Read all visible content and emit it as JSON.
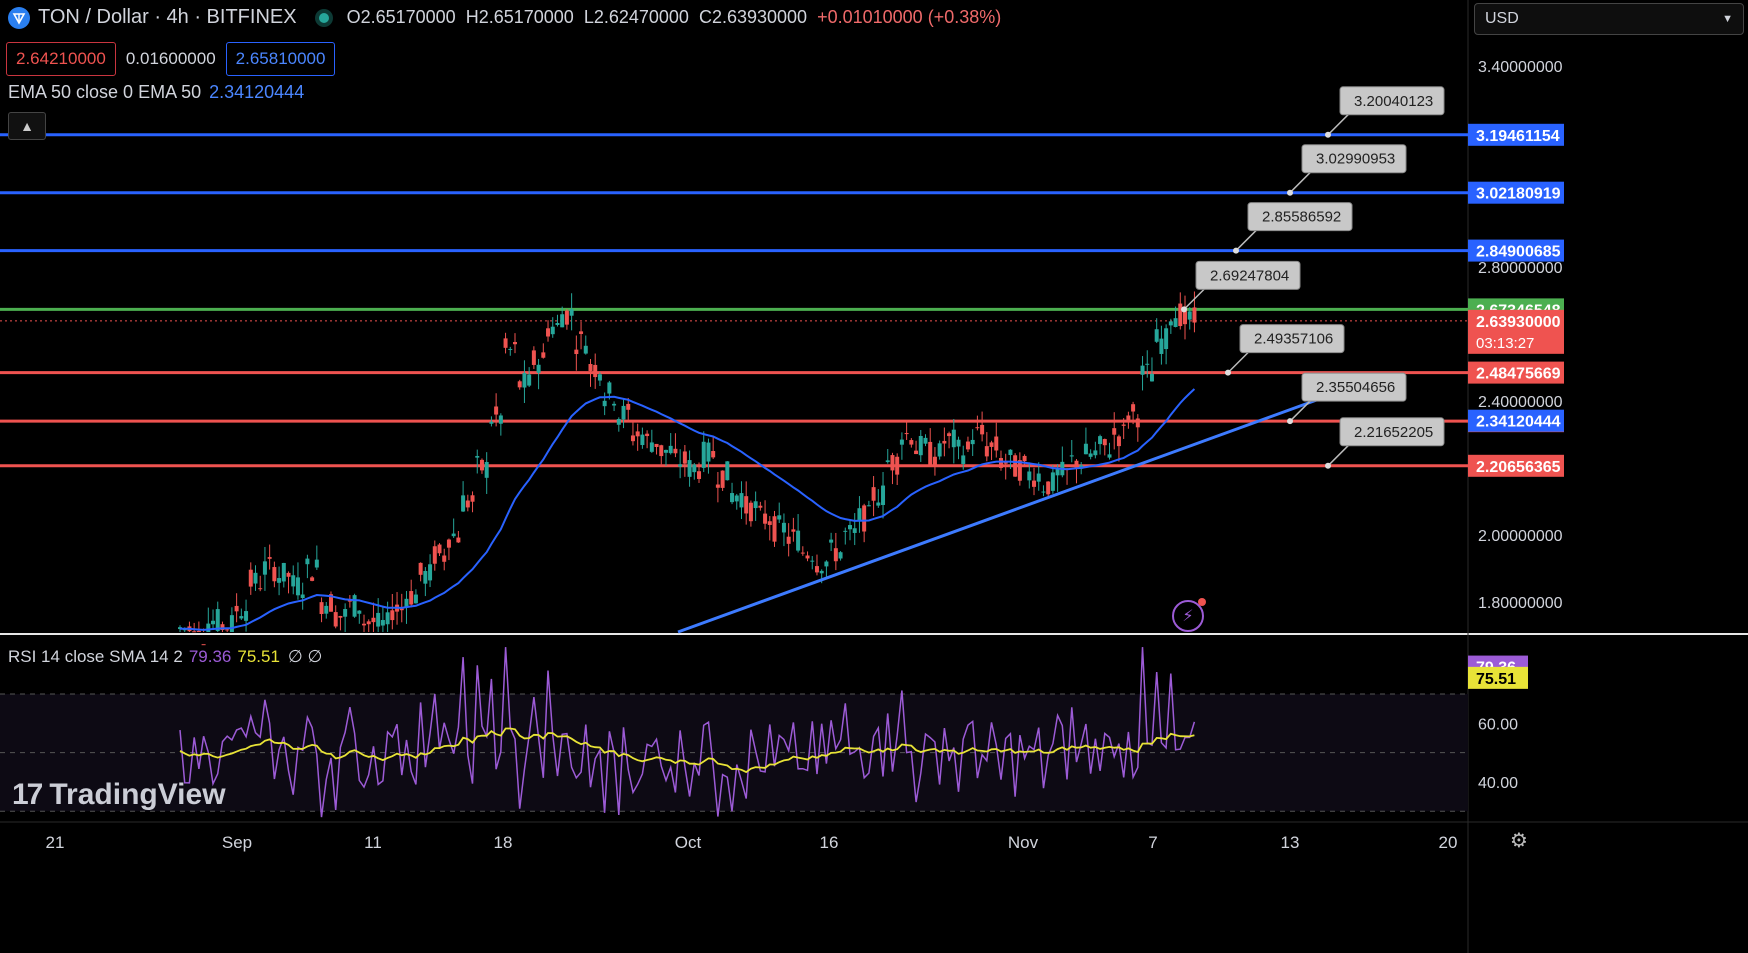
{
  "header": {
    "symbol": "TON / Dollar · 4h · BITFINEX",
    "open": "O2.65170000",
    "high": "H2.65170000",
    "low": "L2.62470000",
    "close": "C2.63930000",
    "change": "+0.01010000 (+0.38%)",
    "bid": "2.64210000",
    "spread": "0.01600000",
    "ask": "2.65810000"
  },
  "ema_legend": {
    "label": "EMA 50 close 0 EMA 50",
    "value": "2.34120444"
  },
  "rsi_legend": {
    "label": "RSI 14 close SMA 14 2",
    "rsi": "79.36",
    "sma": "75.51",
    "extra": "∅ ∅"
  },
  "currency": {
    "label": "USD",
    "chevron-icon": "chevron-down-icon"
  },
  "watermark": {
    "logo": "17",
    "text": "TradingView"
  },
  "colors": {
    "up": "#26a69a",
    "down": "#ef5350",
    "ema": "#2962ff",
    "rsi": "#9c5bd6",
    "rsi_sma": "#e8e337",
    "support": "#ef5350",
    "resistance": "#2962ff",
    "pivot": "#4caf50"
  },
  "chart_data": [
    {
      "type": "candlestick",
      "y_axis_ticks": [
        "3.40000000",
        "2.80000000",
        "2.40000000",
        "2.00000000",
        "1.80000000"
      ],
      "x_axis_ticks": [
        "21",
        "Sep",
        "11",
        "18",
        "Oct",
        "16",
        "Nov",
        "7",
        "13",
        "20"
      ],
      "horizontal_levels": [
        {
          "value": "3.19461154",
          "color": "#2962ff"
        },
        {
          "value": "3.02180919",
          "color": "#2962ff"
        },
        {
          "value": "2.84900685",
          "color": "#2962ff"
        },
        {
          "value": "2.67346548",
          "color": "#4caf50"
        },
        {
          "value": "2.48475669",
          "color": "#ef5350"
        },
        {
          "value": "2.33978285",
          "color": "#ef5350"
        },
        {
          "value": "2.20656365",
          "color": "#ef5350"
        }
      ],
      "ema_value": "2.34120444",
      "last_price": "2.63930000",
      "countdown": "03:13:27",
      "annotations": [
        "3.20040123",
        "3.02990953",
        "2.85586592",
        "2.69247804",
        "2.49357106",
        "2.35504656",
        "2.21652205"
      ],
      "trendline": {
        "from": [
          1.7,
          "Oct"
        ],
        "to": [
          2.46,
          "Nov 13"
        ]
      },
      "price_series": [
        1.72,
        1.7,
        1.74,
        1.73,
        1.78,
        1.86,
        1.9,
        1.88,
        1.85,
        1.9,
        1.8,
        1.76,
        1.79,
        1.74,
        1.73,
        1.78,
        1.82,
        1.88,
        1.94,
        2.0,
        2.1,
        2.2,
        2.35,
        2.55,
        2.45,
        2.52,
        2.62,
        2.66,
        2.58,
        2.5,
        2.42,
        2.36,
        2.3,
        2.28,
        2.25,
        2.22,
        2.2,
        2.24,
        2.18,
        2.12,
        2.08,
        2.05,
        2.02,
        1.99,
        1.95,
        1.92,
        1.95,
        2.0,
        2.05,
        2.12,
        2.22,
        2.3,
        2.26,
        2.24,
        2.28,
        2.25,
        2.3,
        2.26,
        2.22,
        2.2,
        2.18,
        2.15,
        2.18,
        2.22,
        2.24,
        2.26,
        2.3,
        2.36,
        2.48,
        2.58,
        2.66,
        2.64
      ]
    },
    {
      "type": "line",
      "name": "RSI",
      "y_axis_ticks": [
        "60.00",
        "40.00"
      ],
      "rsi_value": "79.36",
      "sma_value": "75.51"
    }
  ]
}
